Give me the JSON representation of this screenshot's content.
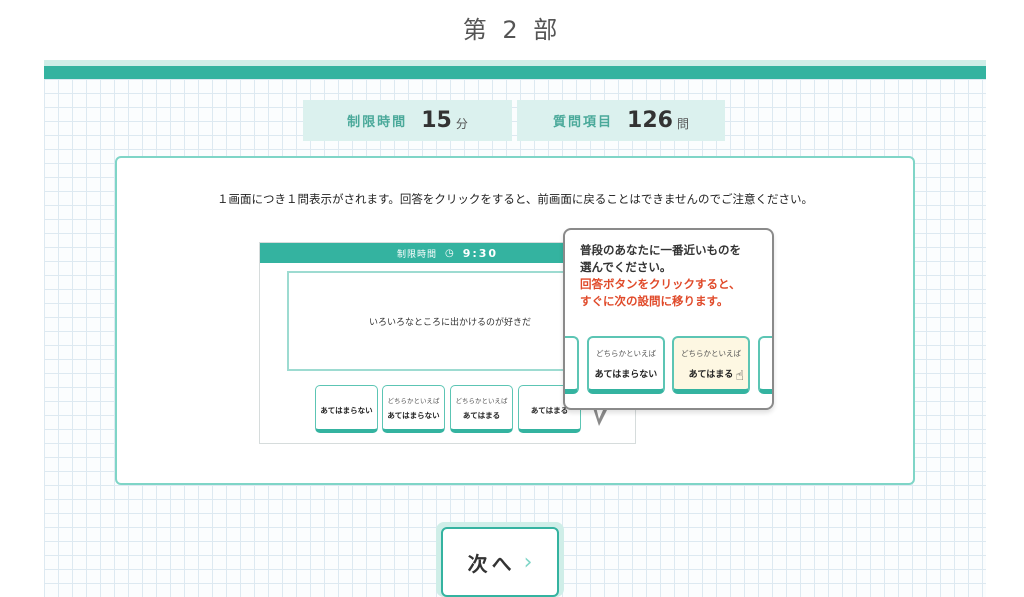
{
  "page": {
    "title": "第 2 部"
  },
  "info": {
    "time_limit_label": "制限時間",
    "time_limit_value": "15",
    "time_limit_unit": "分",
    "items_label": "質問項目",
    "items_value": "126",
    "items_unit": "問"
  },
  "instruction": "１画面につき１問表示がされます。回答をクリックをすると、前画面に戻ることはできませんのでご注意ください。",
  "mock": {
    "header_label": "制限時間",
    "clock_icon": "clock-icon",
    "timer": "9:30",
    "question": "いろいろなところに出かけるのが好きだ",
    "options": [
      {
        "small": "",
        "large": "あてはまらない"
      },
      {
        "small": "どちらかといえば",
        "large": "あてはまらない"
      },
      {
        "small": "どちらかといえば",
        "large": "あてはまる"
      },
      {
        "small": "",
        "large": "あてはまる"
      }
    ]
  },
  "callout": {
    "line1": "普段のあなたに一番近いものを",
    "line2": "選んでください。",
    "line3": "回答ボタンをクリックすると、",
    "line4": "すぐに次の設問に移ります。",
    "options": [
      {
        "small": "どちらかといえば",
        "large": "あてはまらない"
      },
      {
        "small": "どちらかといえば",
        "large": "あてはまる"
      }
    ],
    "cursor_icon": "pointer-hand-icon"
  },
  "next_button": {
    "label": "次へ",
    "icon": "chevron-right-icon"
  },
  "colors": {
    "accent": "#34b3a0",
    "accent_light": "#dbf1ee",
    "warning": "#e04a2a"
  }
}
